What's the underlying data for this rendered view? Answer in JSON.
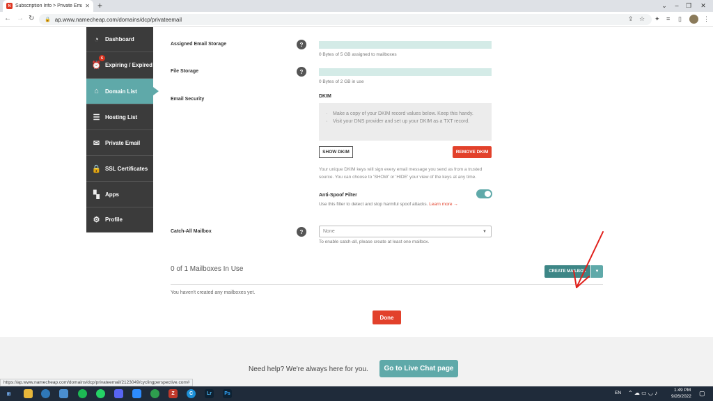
{
  "browser": {
    "tab_title": "Subscription Info > Private Email",
    "url": "ap.www.namecheap.com/domains/dcp/privateemail",
    "status_url": "https://ap.www.namecheap.com/domains/dcp/privateemail/2123049/cyclingperspective.com#"
  },
  "sidebar": {
    "items": [
      {
        "label": "Dashboard",
        "icon": "dashboard-icon"
      },
      {
        "label": "Expiring / Expired",
        "icon": "alarm-clock-icon",
        "badge": "6"
      },
      {
        "label": "Domain List",
        "icon": "home-icon",
        "active": true
      },
      {
        "label": "Hosting List",
        "icon": "server-icon"
      },
      {
        "label": "Private Email",
        "icon": "envelope-icon"
      },
      {
        "label": "SSL Certificates",
        "icon": "lock-icon"
      },
      {
        "label": "Apps",
        "icon": "apps-icon"
      },
      {
        "label": "Profile",
        "icon": "gear-icon"
      }
    ]
  },
  "settings": {
    "email_storage_label": "Assigned Email Storage",
    "email_storage_text": "0 Bytes of 5 GB assigned to mailboxes",
    "file_storage_label": "File Storage",
    "file_storage_text": "0 Bytes of 2 GB in use",
    "email_security_label": "Email Security",
    "dkim_title": "DKIM",
    "dkim_tip_1": "Make a copy of your DKIM record values below. Keep this handy.",
    "dkim_tip_2": "Visit your DNS provider and set up your DKIM as a TXT record.",
    "show_dkim": "SHOW DKIM",
    "remove_dkim": "REMOVE DKIM",
    "dkim_note": "Your unique DKIM keys will sign every email message you send as from a trusted source. You can choose to 'SHOW' or 'HIDE' your view of the keys at any time.",
    "anti_spoof_label": "Anti-Spoof Filter",
    "anti_spoof_text": "Use this filter to detect and stop harmful spoof attacks.",
    "learn_more": "Learn more →",
    "catch_all_label": "Catch-All Mailbox",
    "catch_all_value": "None",
    "catch_all_note": "To enable catch-all, please create at least one mailbox."
  },
  "mailboxes": {
    "heading": "0 of 1 Mailboxes In Use",
    "create_button": "CREATE MAILBOX",
    "empty_text": "You haven't created any mailboxes yet.",
    "done_button": "Done"
  },
  "footer": {
    "help_text": "Need help? We're always here for you.",
    "chat_button": "Go to Live Chat page"
  },
  "taskbar": {
    "lang": "EN",
    "time": "1:49 PM",
    "date": "9/26/2022"
  },
  "colors": {
    "accent": "#5fa9a9",
    "danger": "#e2412b",
    "sidebar": "#3b3b3b"
  }
}
